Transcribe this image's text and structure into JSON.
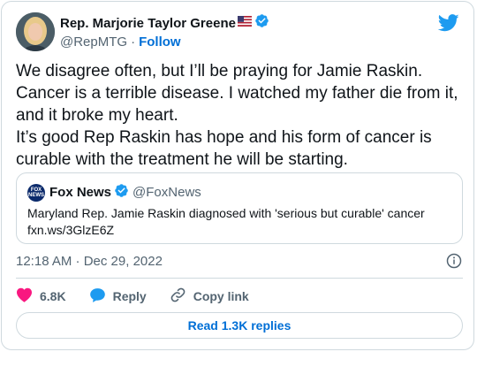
{
  "author": {
    "display_name": "Rep. Marjorie Taylor Greene",
    "handle": "@RepMTG",
    "separator": "·",
    "follow_label": "Follow"
  },
  "tweet": {
    "lines": [
      "We disagree often, but I’ll be praying for Jamie Raskin.",
      "Cancer is a terrible disease.  I watched my father die from it,",
      "and it broke my heart.",
      "It’s good Rep Raskin has hope and his form of cancer is",
      "curable with the treatment he will be starting."
    ]
  },
  "quote": {
    "avatar_text": "FOX NEWS",
    "name": "Fox News",
    "handle": "@FoxNews",
    "text": "Maryland Rep. Jamie Raskin diagnosed with 'serious but curable' cancer",
    "link": "fxn.ws/3GlzE6Z"
  },
  "meta": {
    "timestamp": "12:18 AM · Dec 29, 2022"
  },
  "actions": {
    "likes": "6.8K",
    "reply_label": "Reply",
    "copy_link_label": "Copy link"
  },
  "replies_button": "Read 1.3K replies",
  "colors": {
    "accent_blue": "#1d9bf0",
    "link_blue": "#006fd6",
    "like_pink": "#f91880",
    "muted": "#536471",
    "border": "#cfd9de"
  },
  "icons": [
    "verified-badge-icon",
    "us-flag-icon",
    "twitter-bird-icon",
    "info-icon",
    "heart-icon",
    "reply-bubble-icon",
    "link-icon"
  ]
}
